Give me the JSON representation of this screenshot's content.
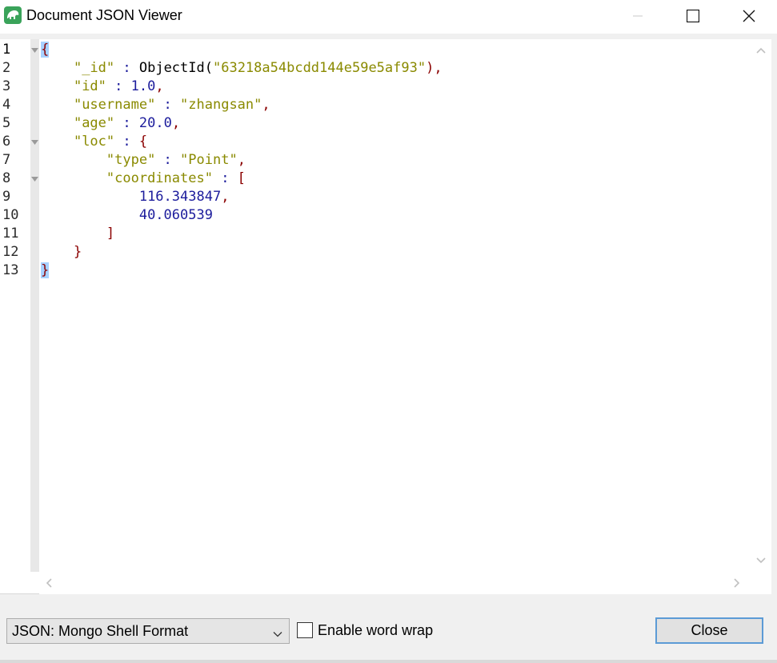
{
  "window": {
    "title": "Document JSON Viewer",
    "icon": "mongo-app-icon",
    "accent_color": "#3aa35a"
  },
  "editor": {
    "line_numbers": [
      "1",
      "2",
      "3",
      "4",
      "5",
      "6",
      "7",
      "8",
      "9",
      "10",
      "11",
      "12",
      "13"
    ],
    "current_line": "1",
    "fold_markers": [
      1,
      6,
      8
    ],
    "lines": [
      [
        {
          "t": "{",
          "c": "brace sel"
        }
      ],
      [
        {
          "t": "    ",
          "c": ""
        },
        {
          "t": "\"_id\"",
          "c": "key"
        },
        {
          "t": " : ",
          "c": "op"
        },
        {
          "t": "ObjectId(",
          "c": "fn"
        },
        {
          "t": "\"63218a54bcdd144e59e5af93\"",
          "c": "str"
        },
        {
          "t": "),",
          "c": "brace"
        }
      ],
      [
        {
          "t": "    ",
          "c": ""
        },
        {
          "t": "\"id\"",
          "c": "key"
        },
        {
          "t": " : ",
          "c": "op"
        },
        {
          "t": "1.0",
          "c": "num"
        },
        {
          "t": ",",
          "c": "brace"
        }
      ],
      [
        {
          "t": "    ",
          "c": ""
        },
        {
          "t": "\"username\"",
          "c": "key"
        },
        {
          "t": " : ",
          "c": "op"
        },
        {
          "t": "\"zhangsan\"",
          "c": "str"
        },
        {
          "t": ",",
          "c": "brace"
        }
      ],
      [
        {
          "t": "    ",
          "c": ""
        },
        {
          "t": "\"age\"",
          "c": "key"
        },
        {
          "t": " : ",
          "c": "op"
        },
        {
          "t": "20.0",
          "c": "num"
        },
        {
          "t": ",",
          "c": "brace"
        }
      ],
      [
        {
          "t": "    ",
          "c": ""
        },
        {
          "t": "\"loc\"",
          "c": "key"
        },
        {
          "t": " : ",
          "c": "op"
        },
        {
          "t": "{",
          "c": "brace"
        }
      ],
      [
        {
          "t": "        ",
          "c": ""
        },
        {
          "t": "\"type\"",
          "c": "key"
        },
        {
          "t": " : ",
          "c": "op"
        },
        {
          "t": "\"Point\"",
          "c": "str"
        },
        {
          "t": ",",
          "c": "brace"
        }
      ],
      [
        {
          "t": "        ",
          "c": ""
        },
        {
          "t": "\"coordinates\"",
          "c": "key"
        },
        {
          "t": " : ",
          "c": "op"
        },
        {
          "t": "[",
          "c": "brace"
        }
      ],
      [
        {
          "t": "            ",
          "c": ""
        },
        {
          "t": "116.343847",
          "c": "num"
        },
        {
          "t": ",",
          "c": "brace"
        }
      ],
      [
        {
          "t": "            ",
          "c": ""
        },
        {
          "t": "40.060539",
          "c": "num"
        }
      ],
      [
        {
          "t": "        ",
          "c": ""
        },
        {
          "t": "]",
          "c": "brace"
        }
      ],
      [
        {
          "t": "    ",
          "c": ""
        },
        {
          "t": "}",
          "c": "brace"
        }
      ],
      [
        {
          "t": "}",
          "c": "brace sel"
        }
      ]
    ]
  },
  "footer": {
    "format_select": {
      "selected": "JSON: Mongo Shell Format"
    },
    "word_wrap": {
      "label": "Enable word wrap",
      "checked": false
    },
    "close_label": "Close"
  }
}
